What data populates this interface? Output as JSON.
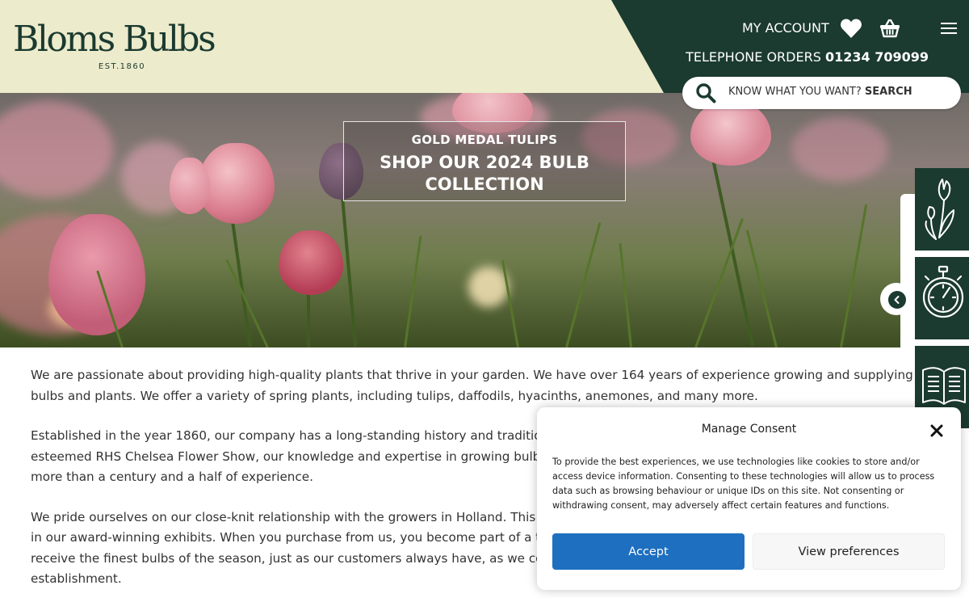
{
  "brand": {
    "name": "Bloms Bulbs",
    "established": "EST.1860"
  },
  "header": {
    "account_label": "MY ACCOUNT",
    "phone_label": "TELEPHONE ORDERS",
    "phone_number": "01234 709099",
    "search_prompt": "KNOW WHAT YOU WANT?",
    "search_action": "SEARCH"
  },
  "hero": {
    "kicker": "GOLD MEDAL TULIPS",
    "title": "SHOP OUR 2024 BULB COLLECTION"
  },
  "content": {
    "paragraphs": [
      "We are passionate about providing high-quality plants that thrive in your garden. We have over 164 years of experience growing and supplying bulbs and plants. We offer a variety of spring plants, including tulips, daffodils, hyacinths, anemones, and many more.",
      "Established in the year 1860, our company has a long-standing history and tradition of excellence. Having won numerous Gold Medals from the esteemed RHS Chelsea Flower Show, our knowledge and expertise in growing bulbs is truly unparalleled. This expertise has been honed over more than a century and a half of experience.",
      "We pride ourselves on our close-knit relationship with the growers in Holland. This partnership ensures our bulbs are the very same ones used in our award-winning exhibits. When you purchase from us, you become part of a tradition that spans over 160 years. Rest assured, you will receive the finest bulbs of the season, just as our customers always have, as we continue to uphold the standards that have been set since our establishment."
    ]
  },
  "consent": {
    "title": "Manage Consent",
    "body": "To provide the best experiences, we use technologies like cookies to store and/or access device information. Consenting to these technologies will allow us to process data such as browsing behaviour or unique IDs on this site. Not consenting or withdrawing consent, may adversely affect certain features and functions.",
    "accept_label": "Accept",
    "preferences_label": "View preferences"
  },
  "colors": {
    "brand_green": "#1b3a30",
    "header_cream": "#ecebcb",
    "accept_blue": "#1e6fbf"
  },
  "icons": [
    "heart-icon",
    "basket-icon",
    "menu-icon",
    "search-icon",
    "tulip-icon",
    "stopwatch-icon",
    "catalogue-icon",
    "chevron-left-icon",
    "close-icon"
  ]
}
